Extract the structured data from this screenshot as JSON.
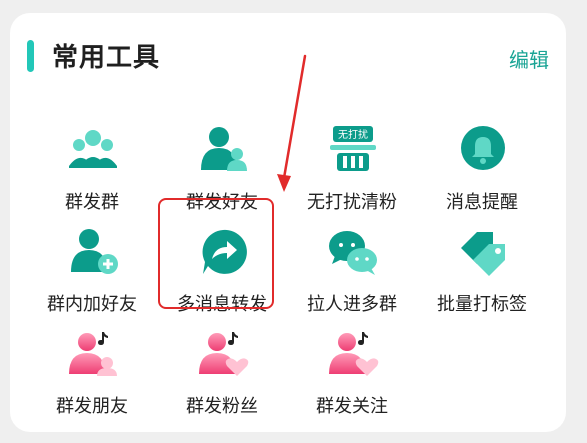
{
  "header": {
    "title": "常用工具",
    "edit_label": "编辑"
  },
  "tools": [
    {
      "label": "群发群",
      "icon": "group-broadcast-icon"
    },
    {
      "label": "群发好友",
      "icon": "friends-broadcast-icon"
    },
    {
      "label": "无打扰清粉",
      "icon": "no-disturb-clean-fans-icon",
      "icon_text": "无打扰"
    },
    {
      "label": "消息提醒",
      "icon": "bell-icon"
    },
    {
      "label": "群内加好友",
      "icon": "add-friend-in-group-icon"
    },
    {
      "label": "多消息转发",
      "icon": "forward-icon"
    },
    {
      "label": "拉人进多群",
      "icon": "chat-bubbles-icon"
    },
    {
      "label": "批量打标签",
      "icon": "tag-icon"
    },
    {
      "label": "群发朋友",
      "icon": "douyin-friends-icon"
    },
    {
      "label": "群发粉丝",
      "icon": "douyin-fans-icon"
    },
    {
      "label": "群发关注",
      "icon": "douyin-follow-icon"
    }
  ],
  "colors": {
    "accent": "#22c7b8",
    "teal_dark": "#0c9c8b",
    "teal_light": "#5fd8c6",
    "edit": "#1aa495",
    "highlight": "#e12b2b",
    "pink": "#f04d7e"
  }
}
